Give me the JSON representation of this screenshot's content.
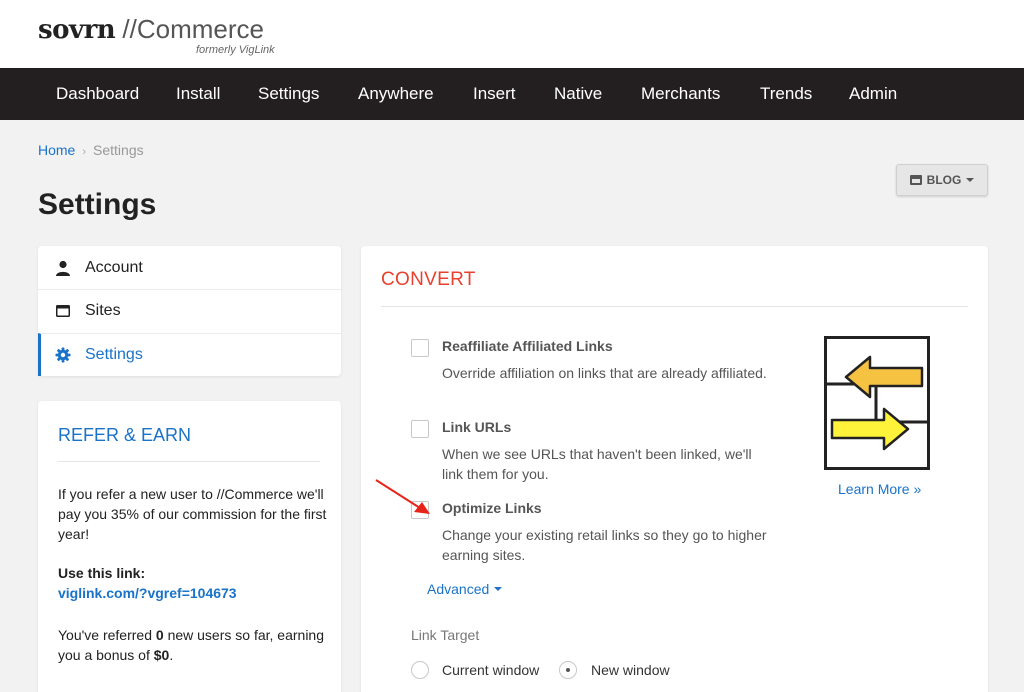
{
  "header": {
    "brand": "sovrn",
    "brand_suffix": " //Commerce",
    "subtitle": "formerly VigLink"
  },
  "nav": {
    "items": [
      "Dashboard",
      "Install",
      "Settings",
      "Anywhere",
      "Insert",
      "Native",
      "Merchants",
      "Trends",
      "Admin"
    ]
  },
  "breadcrumb": {
    "home": "Home",
    "separator": "›",
    "current": "Settings"
  },
  "page": {
    "title": "Settings",
    "site_button": "BLOG"
  },
  "sidebar": {
    "items": [
      {
        "label": "Account",
        "icon": "user-icon"
      },
      {
        "label": "Sites",
        "icon": "window-icon"
      },
      {
        "label": "Settings",
        "icon": "gear-icon",
        "active": true
      }
    ]
  },
  "refer": {
    "title": "REFER & EARN",
    "text": "If you refer a new user to //Commerce we'll pay you 35% of our commission for the first year!",
    "link_label": "Use this link:",
    "link": "viglink.com/?vgref=104673",
    "stat_prefix": "You've referred ",
    "stat_count": "0",
    "stat_mid": " new users so far, earning you a bonus of ",
    "stat_bonus": "$0",
    "stat_suffix": "."
  },
  "convert": {
    "title": "CONVERT",
    "options": [
      {
        "label": "Reaffiliate Affiliated Links",
        "desc": "Override affiliation on links that are already affiliated.",
        "checked": false
      },
      {
        "label": "Link URLs",
        "desc": "When we see URLs that haven't been linked, we'll link them for you.",
        "checked": false
      },
      {
        "label": "Optimize Links",
        "desc": "Change your existing retail links so they go to higher earning sites.",
        "checked": false
      }
    ],
    "advanced": "Advanced",
    "link_target_label": "Link Target",
    "targets": [
      {
        "label": "Current window",
        "checked": false
      },
      {
        "label": "New window",
        "checked": true
      }
    ],
    "learn_more": "Learn More »"
  },
  "colors": {
    "accent": "#1a73c8",
    "nav_bg": "#231f20",
    "convert_title": "#e8422f",
    "arrow": "#e8231a",
    "illus_left": "#f5c242",
    "illus_right": "#fff23a"
  }
}
